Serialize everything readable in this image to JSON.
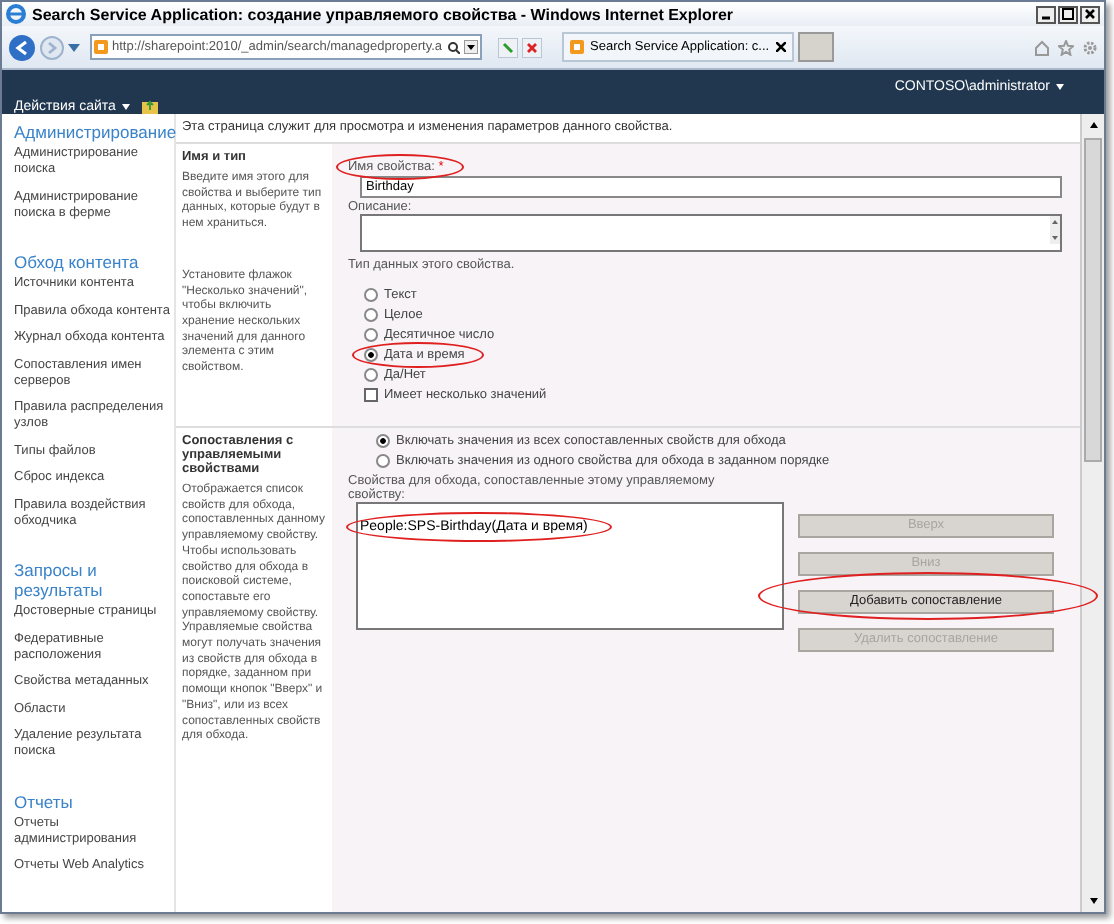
{
  "window": {
    "title": "Search Service Application: создание управляемого свойства - Windows Internet Explorer"
  },
  "browser": {
    "address": "http://sharepoint:2010/_admin/search/managedproperty.a",
    "tab": "Search Service Application: c..."
  },
  "header": {
    "user": "CONTOSO\\administrator",
    "site_actions": "Действия сайта"
  },
  "sidebar": {
    "sections": [
      {
        "heading": "Администрирование",
        "items": [
          "Администрирование поиска",
          "Администрирование поиска в ферме"
        ]
      },
      {
        "heading": "Обход контента",
        "items": [
          "Источники контента",
          "Правила обхода контента",
          "Журнал обхода контента",
          "Сопоставления имен серверов",
          "Правила распределения узлов",
          "Типы файлов",
          "Сброс индекса",
          "Правила воздействия обходчика"
        ]
      },
      {
        "heading": "Запросы и результаты",
        "items": [
          "Достоверные страницы",
          "Федеративные расположения",
          "Свойства метаданных",
          "Области",
          "Удаление результата поиска"
        ]
      },
      {
        "heading": "Отчеты",
        "items": [
          "Отчеты администрирования",
          "Отчеты Web Analytics"
        ]
      }
    ]
  },
  "intro": "Эта страница служит для просмотра и изменения параметров данного свойства.",
  "name_type": {
    "title": "Имя и тип",
    "description": "Введите имя этого для свойства и выберите тип данных, которые будут в нем храниться.",
    "multi_description": "Установите флажок \"Несколько значений\", чтобы включить хранение нескольких значений для данного элемента с этим свойством.",
    "name_label": "Имя свойства:",
    "required_mark": "*",
    "name_value": "Birthday",
    "name_highlighted": true,
    "description_label": "Описание:",
    "type_label": "Тип данных этого свойства.",
    "types": [
      {
        "label": "Текст",
        "selected": false,
        "highlighted": false
      },
      {
        "label": "Целое",
        "selected": false,
        "highlighted": false
      },
      {
        "label": "Десятичное число",
        "selected": false,
        "highlighted": false
      },
      {
        "label": "Дата и время",
        "selected": true,
        "highlighted": true
      },
      {
        "label": "Да/Нет",
        "selected": false,
        "highlighted": false
      }
    ],
    "multi_value": {
      "label": "Имеет несколько значений",
      "checked": false
    }
  },
  "mappings": {
    "title": "Сопоставления с управляемыми свойствами",
    "description": "Отображается список свойств для обхода, сопоставленных данному управляемому свойству. Чтобы использовать свойство для обхода в поисковой системе, сопоставьте его управляемому свойству. Управляемые свойства могут получать значения из свойств для обхода в порядке, заданном при помощи кнопок \"Вверх\" и \"Вниз\", или из всех сопоставленных свойств для обхода.",
    "modes": [
      {
        "label": "Включать значения из всех сопоставленных свойств для обхода",
        "selected": true
      },
      {
        "label": "Включать значения из одного свойства для обхода в заданном порядке",
        "selected": false
      }
    ],
    "list_label": "Свойства для обхода, сопоставленные этому управляемому свойству:",
    "items": [
      {
        "label": "People:SPS-Birthday(Дата и время)",
        "highlighted": true
      }
    ],
    "buttons": [
      {
        "label": "Вверх",
        "disabled": true,
        "highlighted": false
      },
      {
        "label": "Вниз",
        "disabled": true,
        "highlighted": false
      },
      {
        "label": "Добавить сопоставление",
        "disabled": false,
        "highlighted": true
      },
      {
        "label": "Удалить сопоставление",
        "disabled": true,
        "highlighted": false
      }
    ]
  }
}
